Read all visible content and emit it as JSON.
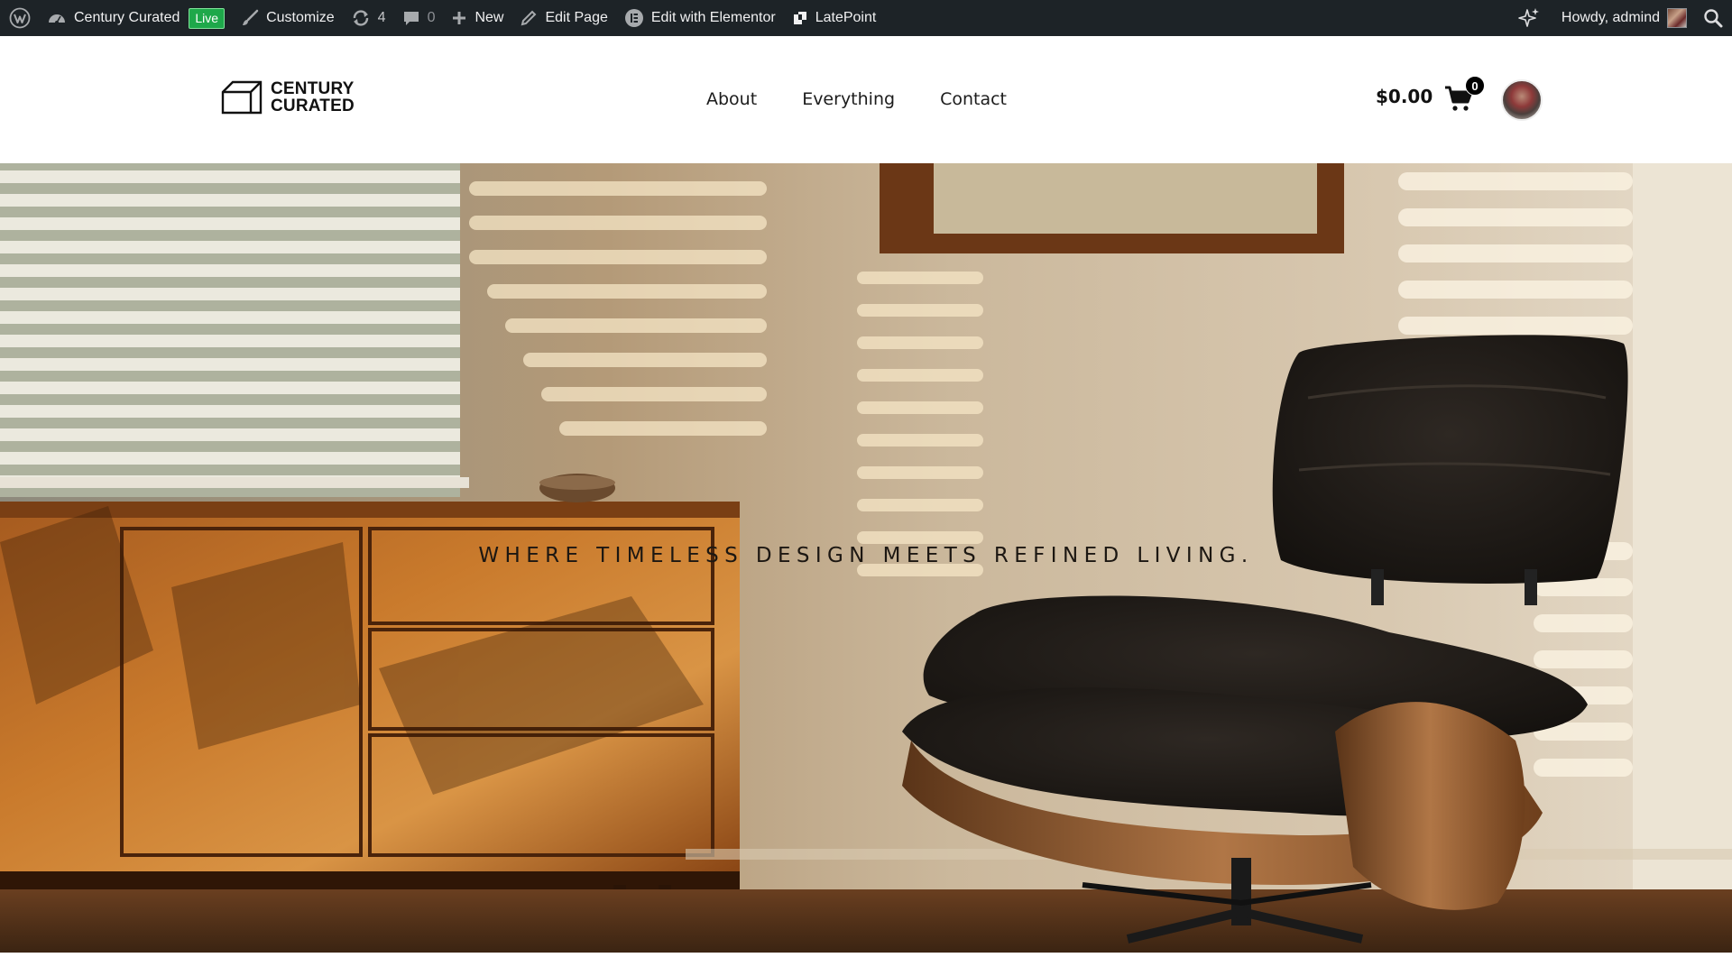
{
  "admin_bar": {
    "wp_logo_icon": "wordpress-icon",
    "site_name": "Century Curated",
    "live_badge": "Live",
    "customize": "Customize",
    "updates_count": "4",
    "comments_count": "0",
    "new": "New",
    "edit_page": "Edit Page",
    "edit_elementor": "Edit with Elementor",
    "latepoint": "LatePoint",
    "howdy": "Howdy, admind"
  },
  "header": {
    "logo_line1": "CENTURY",
    "logo_line2": "CURATED",
    "nav": [
      {
        "label": "About"
      },
      {
        "label": "Everything"
      },
      {
        "label": "Contact"
      }
    ],
    "cart_total": "$0.00",
    "cart_count": "0"
  },
  "hero": {
    "tagline": "WHERE TIMELESS DESIGN MEETS REFINED LIVING."
  },
  "colors": {
    "admin_bar_bg": "#1d2327",
    "live_badge_bg": "#1ea84a",
    "header_bg": "#ffffff",
    "text_dark": "#111111"
  }
}
